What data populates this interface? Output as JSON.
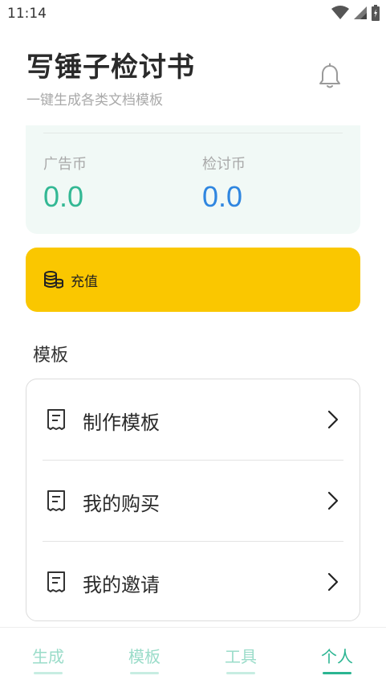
{
  "status_bar": {
    "time": "11:14"
  },
  "header": {
    "title": "写锤子检讨书",
    "subtitle": "一键生成各类文档模板",
    "bell_icon": "bell-icon"
  },
  "wallet": {
    "ad_coin_label": "广告币",
    "ad_coin_value": "0.0",
    "review_coin_label": "检讨币",
    "review_coin_value": "0.0",
    "colors": {
      "ad_coin": "#33b894",
      "review_coin": "#2f86e0"
    }
  },
  "recharge": {
    "label": "充值",
    "icon": "coins-icon",
    "color": "#fac700"
  },
  "templates": {
    "section_title": "模板",
    "items": [
      {
        "label": "制作模板",
        "icon": "receipt-icon"
      },
      {
        "label": "我的购买",
        "icon": "receipt-icon"
      },
      {
        "label": "我的邀请",
        "icon": "receipt-icon"
      }
    ]
  },
  "tabs": [
    {
      "label": "生成"
    },
    {
      "label": "模板"
    },
    {
      "label": "工具"
    },
    {
      "label": "个人",
      "active": true
    }
  ]
}
